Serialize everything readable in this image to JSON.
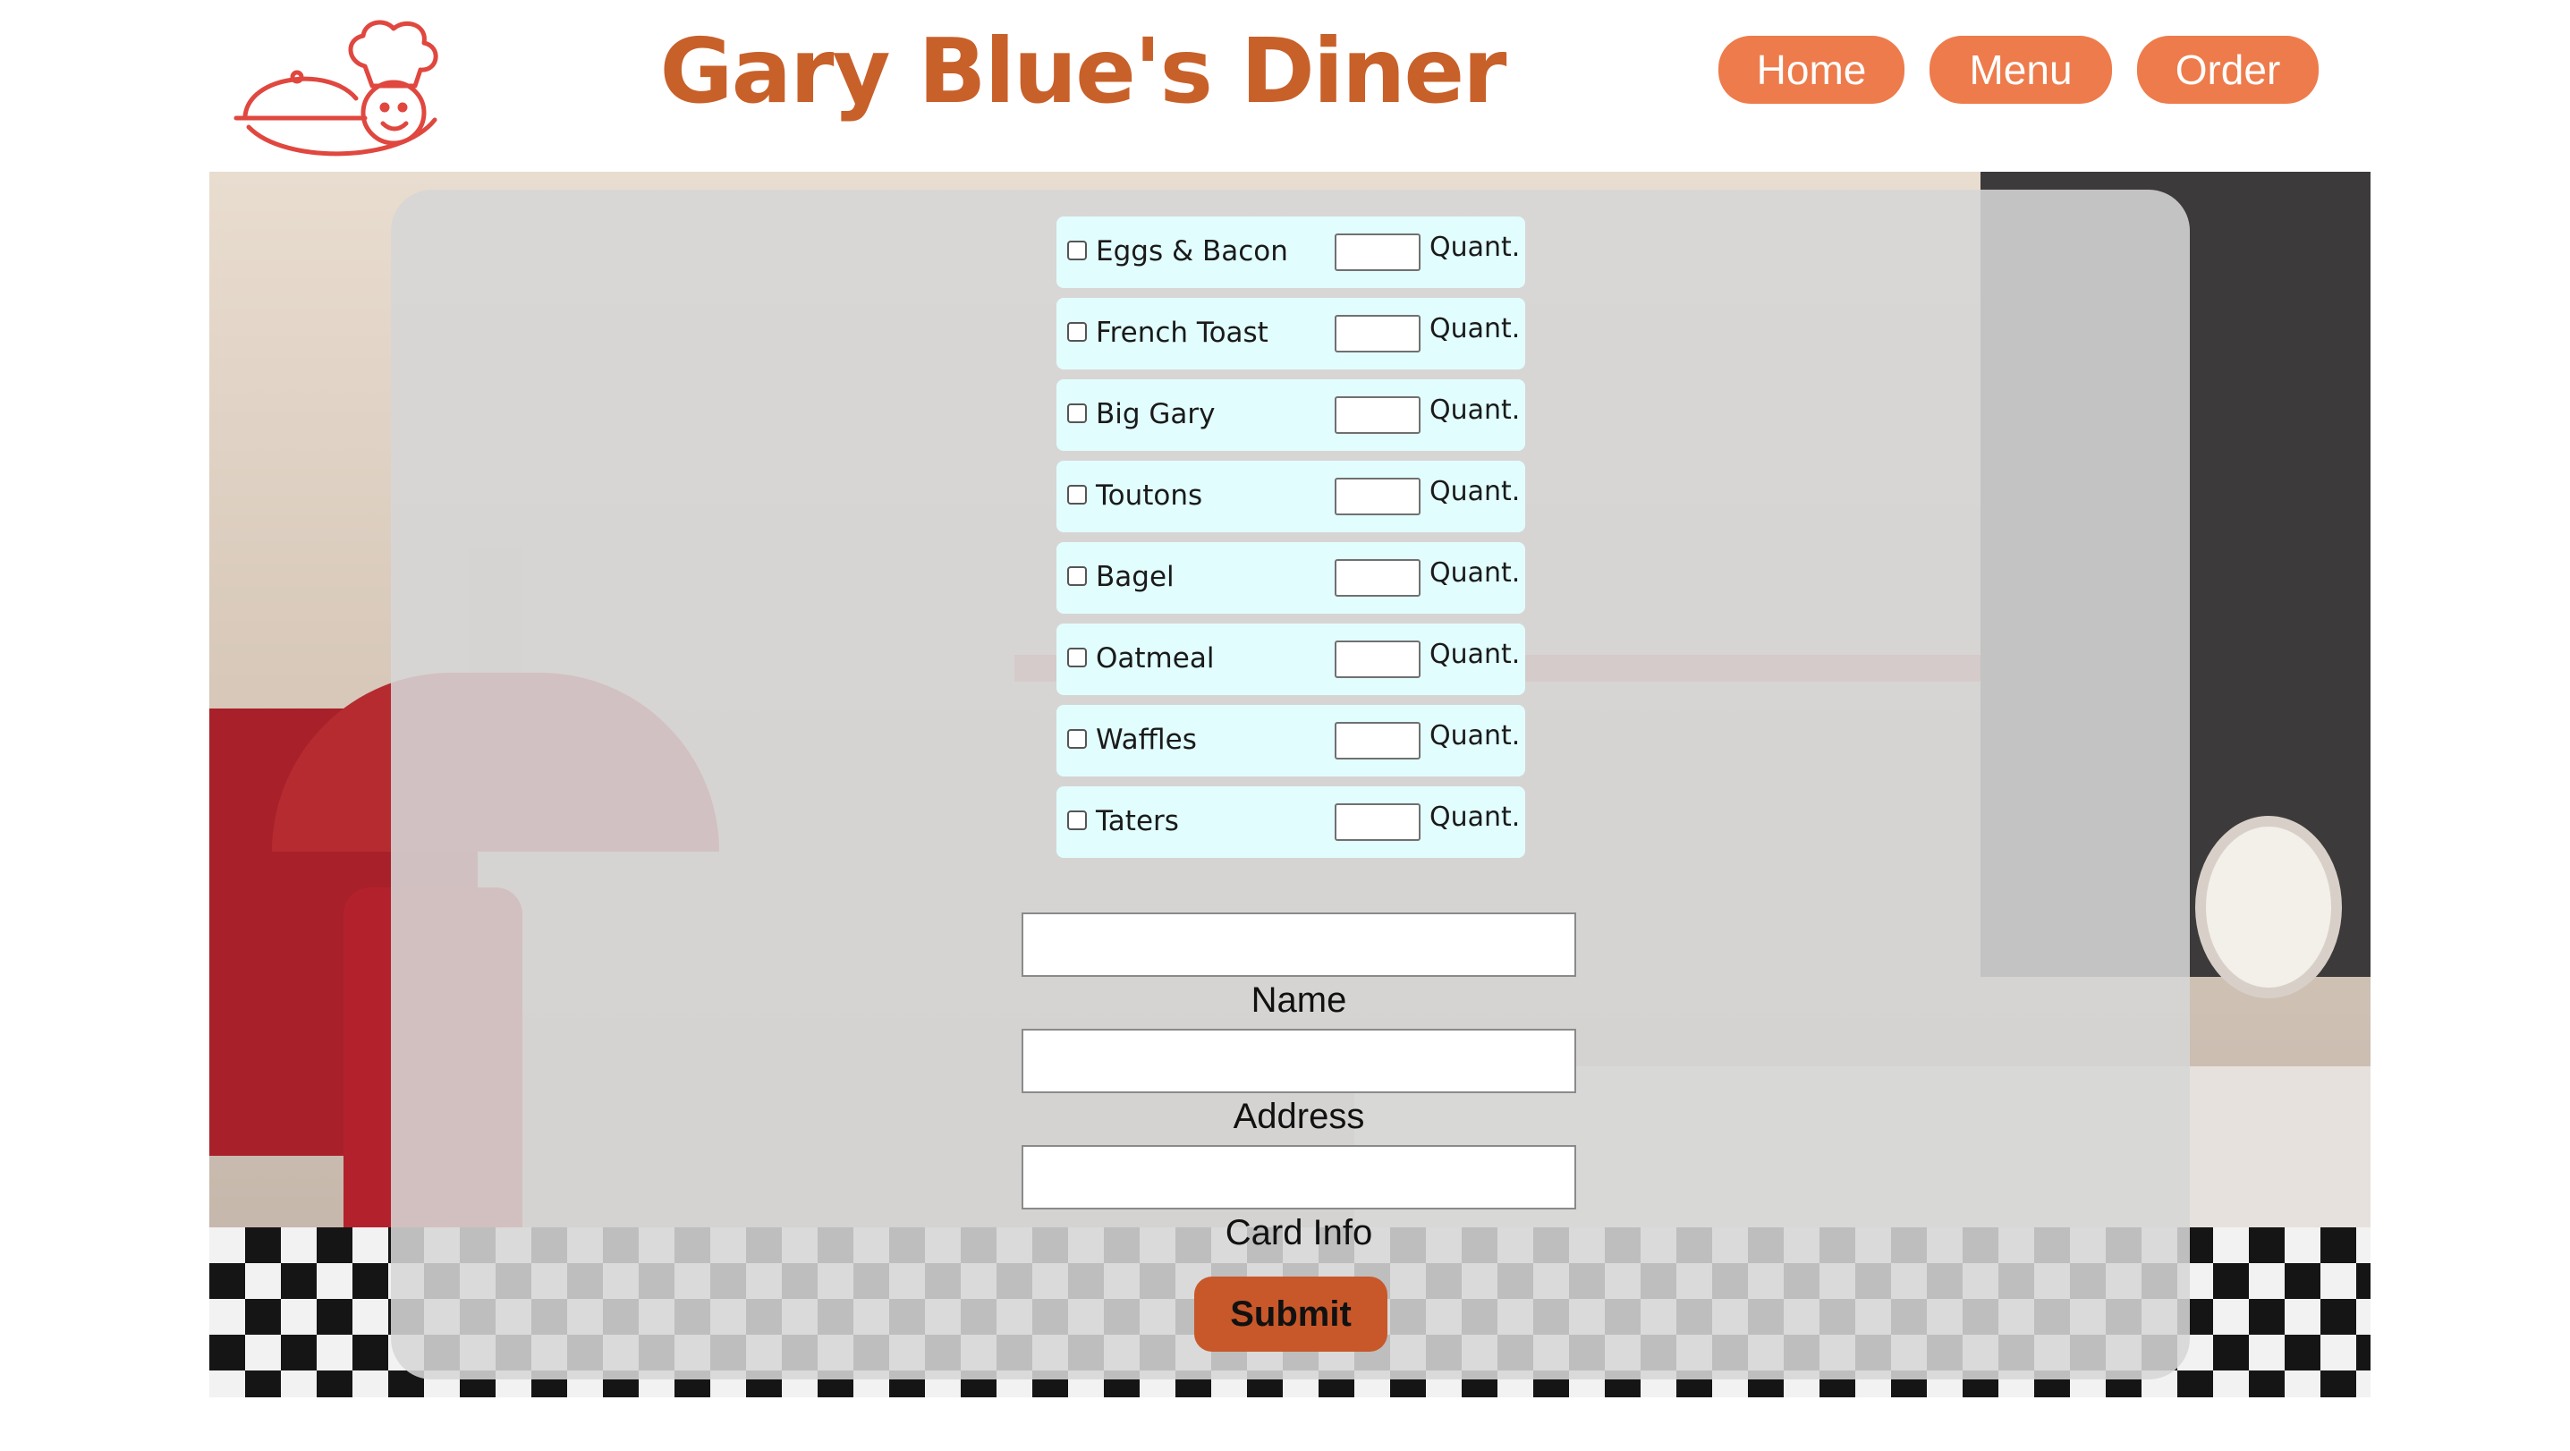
{
  "header": {
    "logo_icon": "chef-with-cloche-icon",
    "title": "Gary Blue's Diner",
    "nav": [
      {
        "label": "Home"
      },
      {
        "label": "Menu"
      },
      {
        "label": "Order"
      }
    ]
  },
  "order_form": {
    "items": [
      {
        "label": "Eggs & Bacon",
        "checked": false,
        "quantity": "",
        "qty_label": "Quant."
      },
      {
        "label": "French Toast",
        "checked": false,
        "quantity": "",
        "qty_label": "Quant."
      },
      {
        "label": "Big Gary",
        "checked": false,
        "quantity": "",
        "qty_label": "Quant."
      },
      {
        "label": "Toutons",
        "checked": false,
        "quantity": "",
        "qty_label": "Quant."
      },
      {
        "label": "Bagel",
        "checked": false,
        "quantity": "",
        "qty_label": "Quant."
      },
      {
        "label": "Oatmeal",
        "checked": false,
        "quantity": "",
        "qty_label": "Quant."
      },
      {
        "label": "Waffles",
        "checked": false,
        "quantity": "",
        "qty_label": "Quant."
      },
      {
        "label": "Taters",
        "checked": false,
        "quantity": "",
        "qty_label": "Quant."
      }
    ],
    "fields": [
      {
        "label": "Name",
        "value": ""
      },
      {
        "label": "Address",
        "value": ""
      },
      {
        "label": "Card Info",
        "value": ""
      }
    ],
    "submit_label": "Submit"
  },
  "colors": {
    "brand": "#c8602a",
    "nav_button": "#ee7b4b",
    "item_row": "#e2fdfd",
    "submit": "#c8582a"
  }
}
